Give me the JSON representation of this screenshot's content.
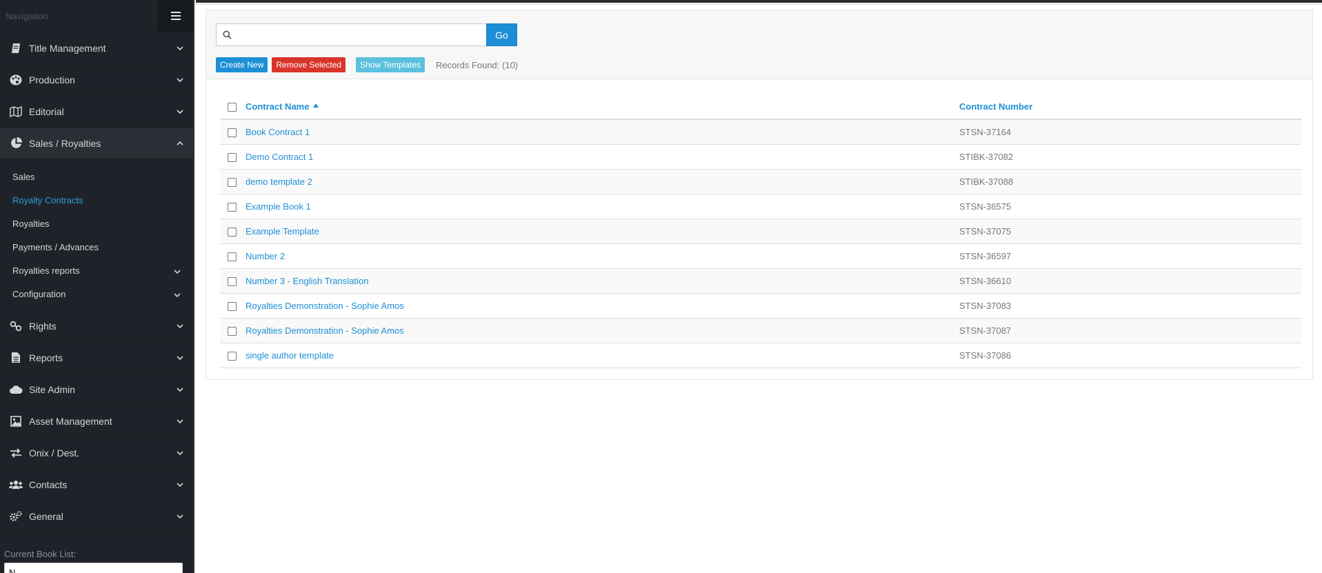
{
  "sidebar": {
    "title": "Navigation",
    "items_top": [
      {
        "label": "Title Management",
        "icon": "book-icon"
      },
      {
        "label": "Production",
        "icon": "palette-icon"
      },
      {
        "label": "Editorial",
        "icon": "map-icon"
      }
    ],
    "open_item": {
      "label": "Sales / Royalties",
      "icon": "pie-chart-icon"
    },
    "sub_items": [
      {
        "label": "Sales",
        "active": false,
        "expandable": false
      },
      {
        "label": "Royalty Contracts",
        "active": true,
        "expandable": false
      },
      {
        "label": "Royalties",
        "active": false,
        "expandable": false
      },
      {
        "label": "Payments / Advances",
        "active": false,
        "expandable": false
      },
      {
        "label": "Royalties reports",
        "active": false,
        "expandable": true
      },
      {
        "label": "Configuration",
        "active": false,
        "expandable": true
      }
    ],
    "items_bottom": [
      {
        "label": "Rights",
        "icon": "link-icon"
      },
      {
        "label": "Reports",
        "icon": "document-icon"
      },
      {
        "label": "Site Admin",
        "icon": "cloud-icon"
      },
      {
        "label": "Asset Management",
        "icon": "image-icon"
      },
      {
        "label": "Onix / Dest.",
        "icon": "exchange-icon"
      },
      {
        "label": "Contacts",
        "icon": "users-icon"
      },
      {
        "label": "General",
        "icon": "gears-icon"
      }
    ],
    "book_list": {
      "label": "Current Book List:",
      "value": "N"
    }
  },
  "search": {
    "value": "",
    "go_label": "Go"
  },
  "actions": {
    "create_label": "Create New",
    "remove_label": "Remove Selected",
    "templates_label": "Show Templates",
    "records_text": "Records Found: (10)"
  },
  "table": {
    "columns": [
      "Contract Name",
      "Contract Number"
    ],
    "sort": {
      "column": "Contract Name",
      "direction": "ascending"
    },
    "rows": [
      {
        "name": "Book Contract 1",
        "number": "STSN-37164"
      },
      {
        "name": "Demo Contract 1",
        "number": "STIBK-37082"
      },
      {
        "name": "demo template 2",
        "number": "STIBK-37088"
      },
      {
        "name": "Example Book 1",
        "number": "STSN-36575"
      },
      {
        "name": "Example Template",
        "number": "STSN-37075"
      },
      {
        "name": "Number 2",
        "number": "STSN-36597"
      },
      {
        "name": "Number 3 - English Translation",
        "number": "STSN-36610"
      },
      {
        "name": "Royalties Demonstration - Sophie Amos",
        "number": "STSN-37083"
      },
      {
        "name": "Royalties Demonstration - Sophie Amos",
        "number": "STSN-37087"
      },
      {
        "name": "single author template",
        "number": "STSN-37086"
      }
    ]
  },
  "colors": {
    "sidebar_bg": "#1f2329",
    "accent": "#1d8fd6",
    "danger": "#d9342b",
    "info": "#5bc0de"
  }
}
